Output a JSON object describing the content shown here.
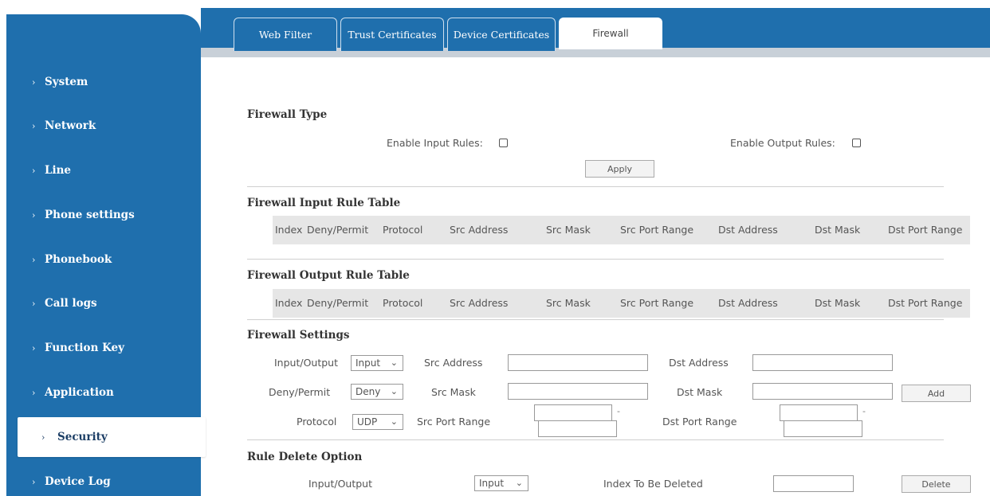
{
  "tabs": [
    {
      "label": "Web Filter",
      "active": false
    },
    {
      "label": "Trust Certificates",
      "active": false
    },
    {
      "label": "Device Certificates",
      "active": false
    },
    {
      "label": "Firewall",
      "active": true
    }
  ],
  "sidebar": {
    "chevron": "›",
    "items": [
      {
        "label": "System"
      },
      {
        "label": "Network"
      },
      {
        "label": "Line"
      },
      {
        "label": "Phone settings"
      },
      {
        "label": "Phonebook"
      },
      {
        "label": "Call logs"
      },
      {
        "label": "Function Key"
      },
      {
        "label": "Application"
      },
      {
        "label": "Security",
        "active": true
      },
      {
        "label": "Device Log"
      }
    ]
  },
  "firewall_type": {
    "title": "Firewall Type",
    "input_rules_label": "Enable Input Rules:",
    "input_rules_checked": false,
    "output_rules_label": "Enable Output Rules:",
    "output_rules_checked": false,
    "apply_label": "Apply"
  },
  "input_table": {
    "title": "Firewall Input Rule Table"
  },
  "output_table": {
    "title": "Firewall Output Rule Table"
  },
  "columns": [
    "Index",
    "Deny/Permit",
    "Protocol",
    "Src Address",
    "Src Mask",
    "Src Port Range",
    "Dst Address",
    "Dst Mask",
    "Dst Port Range"
  ],
  "settings": {
    "title": "Firewall Settings",
    "input_output_label": "Input/Output",
    "input_output_value": "Input",
    "src_address_label": "Src Address",
    "dst_address_label": "Dst Address",
    "deny_permit_label": "Deny/Permit",
    "deny_permit_value": "Deny",
    "src_mask_label": "Src Mask",
    "dst_mask_label": "Dst Mask",
    "add_label": "Add",
    "protocol_label": "Protocol",
    "protocol_value": "UDP",
    "src_port_range_label": "Src Port Range",
    "dst_port_range_label": "Dst Port Range",
    "range_separator": "-"
  },
  "delete": {
    "title": "Rule Delete Option",
    "input_output_label": "Input/Output",
    "input_output_value": "Input",
    "index_label": "Index To Be Deleted",
    "delete_label": "Delete"
  },
  "icons": {
    "select_arrow": "⌄"
  },
  "colors": {
    "primary_blue": "#1f6fad",
    "table_header_bg": "#e6e6e6",
    "tab_strip": "#c8d0d8"
  }
}
